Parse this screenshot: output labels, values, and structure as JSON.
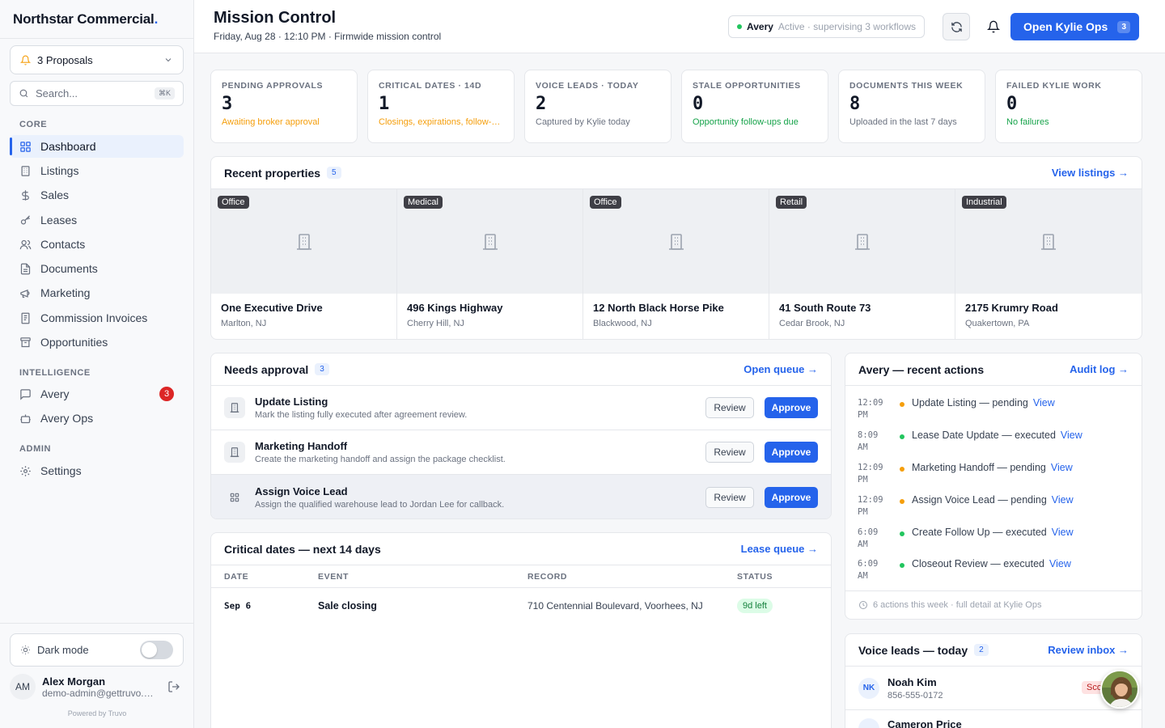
{
  "brand": {
    "name": "Northstar Commercial",
    "dot": "."
  },
  "sidebar": {
    "proposals_label": "3 Proposals",
    "search_placeholder": "Search...",
    "search_kbd": "⌘K",
    "sections": {
      "core": "CORE",
      "intelligence": "INTELLIGENCE",
      "admin": "ADMIN"
    },
    "core_items": [
      {
        "label": "Dashboard",
        "icon": "grid-icon",
        "active": true
      },
      {
        "label": "Listings",
        "icon": "building-icon"
      },
      {
        "label": "Sales",
        "icon": "dollar-icon"
      },
      {
        "label": "Leases",
        "icon": "key-icon"
      },
      {
        "label": "Contacts",
        "icon": "users-icon"
      },
      {
        "label": "Documents",
        "icon": "file-icon"
      },
      {
        "label": "Marketing",
        "icon": "megaphone-icon"
      },
      {
        "label": "Commission Invoices",
        "icon": "invoice-icon"
      },
      {
        "label": "Opportunities",
        "icon": "archive-icon"
      }
    ],
    "intelligence_items": [
      {
        "label": "Avery",
        "icon": "chat-icon",
        "badge": "3"
      },
      {
        "label": "Avery Ops",
        "icon": "robot-icon"
      }
    ],
    "admin_items": [
      {
        "label": "Settings",
        "icon": "gear-icon"
      }
    ],
    "dark_mode_label": "Dark mode",
    "user": {
      "initials": "AM",
      "name": "Alex Morgan",
      "email": "demo-admin@gettruvo.com"
    },
    "powered_by": "Powered by  Truvo"
  },
  "header": {
    "title": "Mission Control",
    "subtitle": "Friday, Aug 28 · 12:10 PM · Firmwide mission control",
    "status_name": "Avery",
    "status_text": "Active · supervising 3 workflows",
    "open_ops_label": "Open Kylie Ops",
    "open_ops_count": "3"
  },
  "stats": [
    {
      "label": "PENDING APPROVALS",
      "value": "3",
      "sub": "Awaiting broker approval",
      "color": "#f59e0b"
    },
    {
      "label": "CRITICAL DATES · 14D",
      "value": "1",
      "sub": "Closings, expirations, follow-ups",
      "color": "#f59e0b"
    },
    {
      "label": "VOICE LEADS · TODAY",
      "value": "2",
      "sub": "Captured by Kylie today",
      "color": "#6b7280"
    },
    {
      "label": "STALE OPPORTUNITIES",
      "value": "0",
      "sub": "Opportunity follow-ups due",
      "color": "#16a34a"
    },
    {
      "label": "DOCUMENTS THIS WEEK",
      "value": "8",
      "sub": "Uploaded in the last 7 days",
      "color": "#6b7280"
    },
    {
      "label": "FAILED KYLIE WORK",
      "value": "0",
      "sub": "No failures",
      "color": "#16a34a"
    }
  ],
  "properties": {
    "title": "Recent properties",
    "count": "5",
    "link": "View listings →",
    "items": [
      {
        "tag": "Office",
        "name": "One Executive Drive",
        "location": "Marlton, NJ"
      },
      {
        "tag": "Medical",
        "name": "496 Kings Highway",
        "location": "Cherry Hill, NJ"
      },
      {
        "tag": "Office",
        "name": "12 North Black Horse Pike",
        "location": "Blackwood, NJ"
      },
      {
        "tag": "Retail",
        "name": "41 South Route 73",
        "location": "Cedar Brook, NJ"
      },
      {
        "tag": "Industrial",
        "name": "2175 Krumry Road",
        "location": "Quakertown, PA"
      }
    ]
  },
  "approvals": {
    "title": "Needs approval",
    "count": "3",
    "link": "Open queue →",
    "review_label": "Review",
    "approve_label": "Approve",
    "items": [
      {
        "title": "Update Listing",
        "desc": "Mark the listing fully executed after agreement review."
      },
      {
        "title": "Marketing Handoff",
        "desc": "Create the marketing handoff and assign the package checklist."
      },
      {
        "title": "Assign Voice Lead",
        "desc": "Assign the qualified warehouse lead to Jordan Lee for callback."
      }
    ]
  },
  "critical": {
    "title": "Critical dates — next 14 days",
    "link": "Lease queue →",
    "columns": [
      "DATE",
      "EVENT",
      "RECORD",
      "STATUS"
    ],
    "rows": [
      {
        "date": "Sep  6",
        "event": "Sale closing",
        "record": "710 Centennial Boulevard, Voorhees, NJ",
        "status": "9d left"
      }
    ]
  },
  "actions": {
    "title": "Avery — recent actions",
    "link": "Audit log →",
    "view_label": "View",
    "items": [
      {
        "time": "12:09 PM",
        "text": "Update Listing — pending",
        "state": "pending"
      },
      {
        "time": "8:09 AM",
        "text": "Lease Date Update — executed",
        "state": "executed"
      },
      {
        "time": "12:09 PM",
        "text": "Marketing Handoff — pending",
        "state": "pending"
      },
      {
        "time": "12:09 PM",
        "text": "Assign Voice Lead — pending",
        "state": "pending"
      },
      {
        "time": "6:09 AM",
        "text": "Create Follow Up — executed",
        "state": "executed"
      },
      {
        "time": "6:09 AM",
        "text": "Closeout Review — executed",
        "state": "executed"
      }
    ],
    "footer": "6 actions this week · full detail at Kylie Ops",
    "colors": {
      "pending": "#f59e0b",
      "executed": "#22c55e"
    }
  },
  "leads": {
    "title": "Voice leads — today",
    "count": "2",
    "link": "Review inbox →",
    "items": [
      {
        "initials": "NK",
        "name": "Noah Kim",
        "phone": "856-555-0172",
        "score": "Sco"
      },
      {
        "initials": "CP",
        "name": "Cameron Price",
        "phone": "",
        "score": ""
      }
    ]
  },
  "colors": {
    "accent": "#2563eb",
    "danger": "#dc2626"
  }
}
